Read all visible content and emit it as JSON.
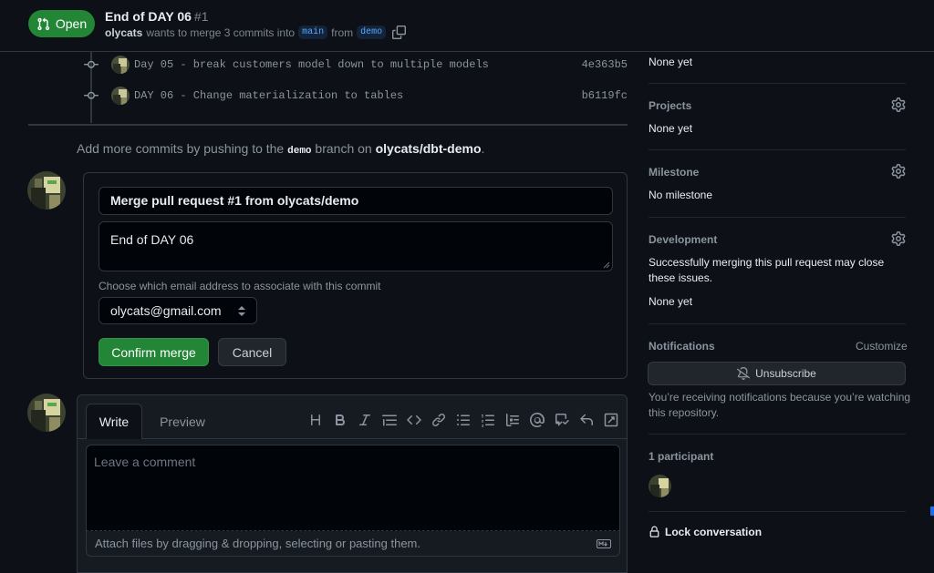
{
  "header": {
    "state": "Open",
    "title": "End of DAY 06",
    "number": "#1",
    "author": "olycats",
    "meta_text": "wants to merge 3 commits into",
    "base_branch": "main",
    "from_text": "from",
    "head_branch": "demo"
  },
  "commits": [
    {
      "message": "Day 05 - break customers model down to multiple models",
      "sha": "4e363b5"
    },
    {
      "message": "DAY 06 - Change materialization to tables",
      "sha": "b6119fc"
    }
  ],
  "push_note": {
    "prefix": "Add more commits by pushing to the",
    "branch": "demo",
    "middle": "branch on",
    "repo": "olycats/dbt-demo",
    "suffix": "."
  },
  "merge": {
    "commit_title": "Merge pull request #1 from olycats/demo",
    "commit_body": "End of DAY 06",
    "email_label": "Choose which email address to associate with this commit",
    "email_value": "olycats@gmail.com",
    "confirm_label": "Confirm merge",
    "cancel_label": "Cancel"
  },
  "comment": {
    "tab_write": "Write",
    "tab_preview": "Preview",
    "placeholder": "Leave a comment",
    "attach_text": "Attach files by dragging & dropping, selecting or pasting them."
  },
  "sidebar": {
    "reviewers_value": "None yet",
    "projects_heading": "Projects",
    "projects_value": "None yet",
    "milestone_heading": "Milestone",
    "milestone_value": "No milestone",
    "development_heading": "Development",
    "development_text": "Successfully merging this pull request may close these issues.",
    "development_value": "None yet",
    "notifications_heading": "Notifications",
    "customize_label": "Customize",
    "unsubscribe_label": "Unsubscribe",
    "notifications_reason": "You’re receiving notifications because you’re watching this repository.",
    "participants_heading": "1 participant",
    "lock_label": "Lock conversation"
  },
  "colors": {
    "accent_green": "#238636",
    "background": "#0d1117",
    "border": "#30363d",
    "link_blue": "#58a6ff"
  }
}
